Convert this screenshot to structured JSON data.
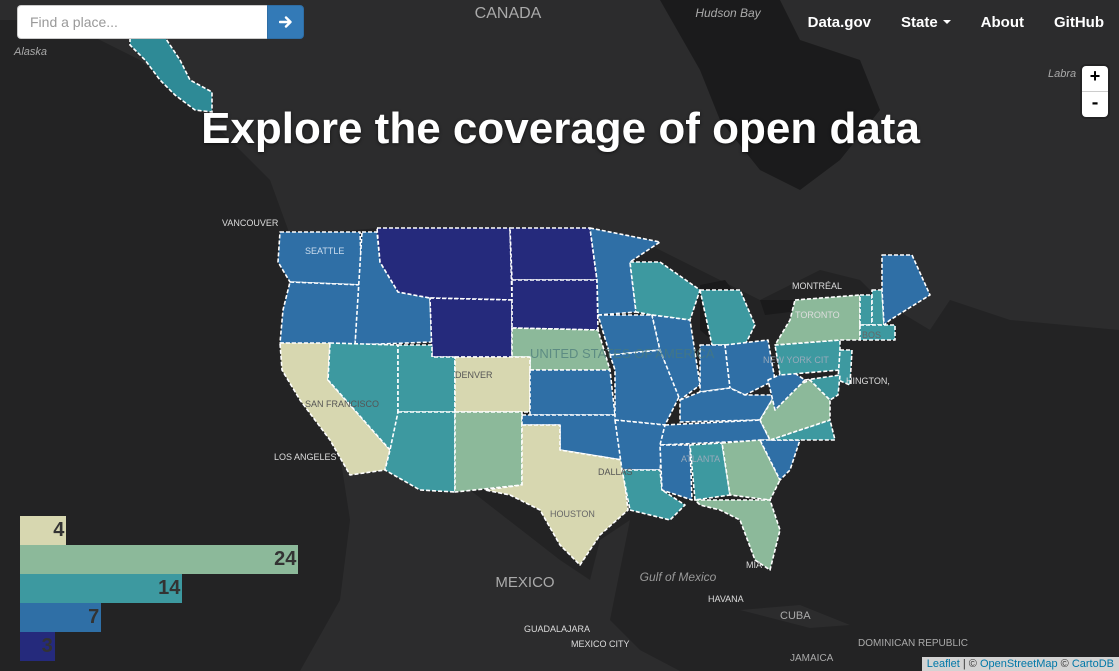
{
  "search": {
    "placeholder": "Find a place...",
    "submit_icon": "arrow-right-icon"
  },
  "nav": {
    "datagov": "Data.gov",
    "state": "State",
    "about": "About",
    "github": "GitHub"
  },
  "zoom": {
    "in": "+",
    "out": "-"
  },
  "headline": "Explore the coverage of open data",
  "map_labels": {
    "canada": "CANADA",
    "hudson_bay": "Hudson Bay",
    "alaska": "Alaska",
    "labrador": "Labra",
    "vancouver": "VANCOUVER",
    "seattle": "SEATTLE",
    "san_francisco": "SAN FRANCISCO",
    "los_angeles": "LOS ANGELES",
    "denver": "DENVER",
    "dallas": "DALLAS",
    "houston": "HOUSTON",
    "montreal": "MONTRÉAL",
    "toronto": "TORONTO",
    "boston": "BOS",
    "new_york": "NEW YORK CIT",
    "washington": "HINGTON,",
    "atlanta": "ATLANTA",
    "united_states": "UNITED STATES OF AMERICA",
    "mexico": "MEXICO",
    "gulf": "Gulf of Mexico",
    "guadalajara": "GUADALAJARA",
    "mexico_city": "MEXICO CITY",
    "havana": "HAVANA",
    "cuba": "CUBA",
    "miami": "MIA",
    "jamaica": "JAMAICA",
    "dominican": "DOMINICAN REPUBLIC"
  },
  "legend": [
    {
      "value": "4",
      "count": 4,
      "color": "#d7d7b0"
    },
    {
      "value": "24",
      "count": 24,
      "color": "#8cb99a"
    },
    {
      "value": "14",
      "count": 14,
      "color": "#3d99a0"
    },
    {
      "value": "7",
      "count": 7,
      "color": "#2f6fa6"
    },
    {
      "value": "3",
      "count": 3,
      "color": "#252a7c"
    }
  ],
  "attribution": {
    "leaflet": "Leaflet",
    "sep1": " | © ",
    "osm": "OpenStreetMap",
    "sep2": " © ",
    "carto": "CartoDB"
  }
}
